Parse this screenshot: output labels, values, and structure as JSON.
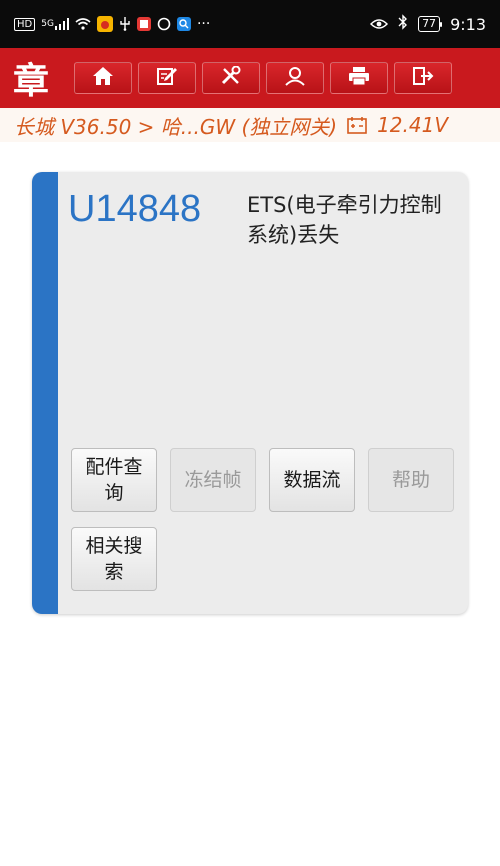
{
  "status_bar": {
    "left_icons": [
      "hd-icon",
      "signal-5g-icon",
      "wifi-icon",
      "weibo-icon",
      "usb-debug-icon",
      "red-app-icon",
      "circle-app-icon",
      "search-app-icon"
    ],
    "hd_label": "HD",
    "net_label": "5G",
    "overflow": "···",
    "battery": "77",
    "time": "9:13"
  },
  "app_toolbar": {
    "logo_text": "章",
    "brand_color": "#c9191e",
    "buttons": [
      "home-icon",
      "edit-icon",
      "tools-icon",
      "user-icon",
      "print-icon",
      "exit-icon"
    ]
  },
  "breadcrumb": {
    "text": "长城 V36.50 > 哈...GW (独立网关)",
    "voltage": "12.41V"
  },
  "dtc": {
    "code": "U14848",
    "description": "ETS(电子牵引力控制系统)丢失"
  },
  "actions": {
    "parts_query": "配件查询",
    "freeze_frame": "冻结帧",
    "data_stream": "数据流",
    "help": "帮助",
    "related_search": "相关搜索"
  },
  "colors": {
    "accent_blue": "#2b74c5",
    "breadcrumb_orange": "#d55a1f"
  }
}
